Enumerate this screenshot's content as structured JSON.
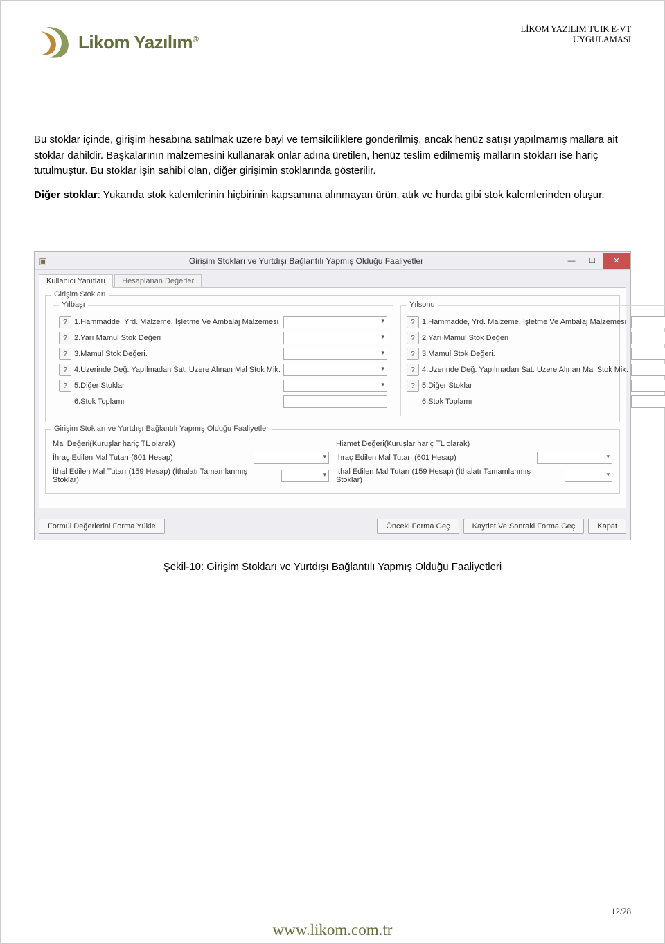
{
  "header": {
    "logo_text": "Likom Yazılım",
    "right_line1": "LİKOM YAZILIM TUIK E-VT",
    "right_line2": "UYGULAMASI"
  },
  "paragraphs": {
    "p1": "Bu stoklar içinde, girişim hesabına satılmak üzere bayi ve temsilciliklere gönderilmiş, ancak henüz satışı yapılmamış mallara ait stoklar dahildir. Başkalarının malzemesini kullanarak onlar adına üretilen, henüz teslim edilmemiş malların stokları ise hariç tutulmuştur. Bu stoklar işin sahibi olan, diğer girişimin stoklarında gösterilir.",
    "p2_bold": "Diğer stoklar",
    "p2_rest": ": Yukarıda stok kalemlerinin hiçbirinin kapsamına alınmayan ürün, atık ve hurda gibi stok kalemlerinden oluşur."
  },
  "window": {
    "title": "Girişim Stokları ve Yurtdışı Bağlantılı Yapmış Olduğu Faaliyetler",
    "tabs": {
      "tab1": "Kullanıcı Yanıtları",
      "tab2": "Hesaplanan Değerler"
    },
    "group1_title": "Girişim Stokları",
    "sub_left_title": "Yılbaşı",
    "sub_right_title": "Yılsonu",
    "rows_left": [
      "1.Hammadde, Yrd. Malzeme, İşletme Ve Ambalaj Malzemesi",
      "2.Yarı Mamul Stok Değeri",
      "3.Mamul Stok Değeri.",
      "4.Üzerinde Değ. Yapılmadan Sat. Üzere Alınan Mal Stok Mik.",
      "5.Diğer Stoklar",
      "6.Stok Toplamı"
    ],
    "rows_right": [
      "1.Hammadde, Yrd. Malzeme, İşletme Ve Ambalaj Malzemesi",
      "2.Yarı Mamul Stok Değeri",
      "3.Mamul Stok Değeri.",
      "4.Üzerinde Değ. Yapılmadan Sat. Üzere Alınan Mal Stok Mik.",
      "5.Diğer Stoklar",
      "6.Stok Toplamı"
    ],
    "group2_title": "Girişim Stokları ve Yurtdışı Bağlantılı Yapmış Olduğu Faaliyetler",
    "g2_left": [
      "Mal Değeri(Kuruşlar hariç TL olarak)",
      "İhraç Edilen Mal Tutarı (601 Hesap)",
      "İthal Edilen Mal Tutarı (159 Hesap) (İthalatı Tamamlanmış Stoklar)"
    ],
    "g2_right": [
      "Hizmet Değeri(Kuruşlar hariç TL olarak)",
      "İhraç Edilen Mal Tutarı (601 Hesap)",
      "İthal Edilen Mal Tutarı (159 Hesap) (İthalatı Tamamlanmış Stoklar)"
    ],
    "buttons": {
      "load": "Formül Değerlerini Forma Yükle",
      "prev": "Önceki Forma Geç",
      "save_next": "Kaydet Ve Sonraki Forma Geç",
      "close": "Kapat"
    }
  },
  "caption": "Şekil-10: Girişim Stokları ve Yurtdışı Bağlantılı Yapmış Olduğu Faaliyetleri",
  "footer": {
    "page": "12/28",
    "url": "www.likom.com.tr"
  }
}
